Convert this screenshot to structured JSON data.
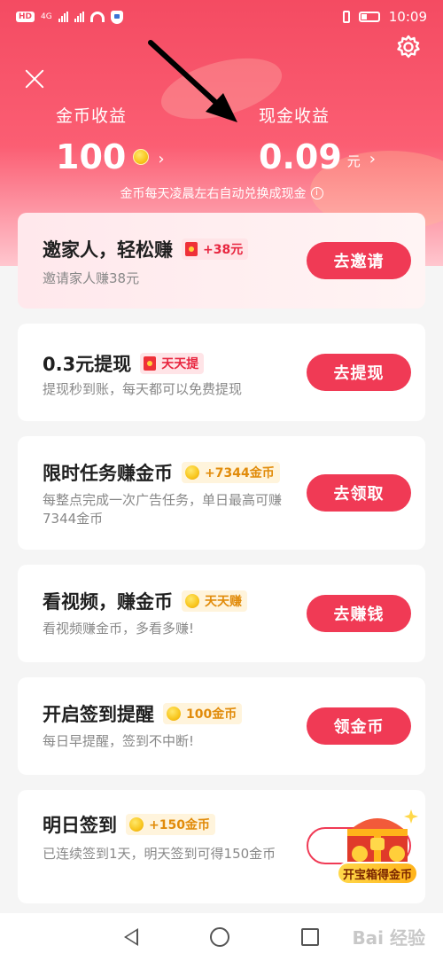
{
  "statusbar": {
    "chip": "HD",
    "network": "4G",
    "time": "10:09"
  },
  "header": {
    "coin_label": "金币收益",
    "coin_value": "100",
    "cash_label": "现金收益",
    "cash_value": "0.09",
    "cash_unit": "元",
    "hint": "金币每天凌晨左右自动兑换成现金"
  },
  "cards": [
    {
      "title": "邀家人，轻松赚",
      "tag": "+38元",
      "desc": "邀请家人赚38元",
      "button": "去邀请"
    },
    {
      "title": "0.3元提现",
      "tag": "天天提",
      "desc": "提现秒到账，每天都可以免费提现",
      "button": "去提现"
    },
    {
      "title": "限时任务赚金币",
      "tag": "+7344金币",
      "desc": "每整点完成一次广告任务，单日最高可赚7344金币",
      "button": "去领取"
    },
    {
      "title": "看视频，赚金币",
      "tag": "天天赚",
      "desc": "看视频赚金币，多看多赚!",
      "button": "去赚钱"
    },
    {
      "title": "开启签到提醒",
      "tag": "100金币",
      "desc": "每日早提醒，签到不中断!",
      "button": "领金币"
    },
    {
      "title": "明日签到",
      "tag": "+150金币",
      "desc": "已连续签到1天，明天签到可得150金币",
      "button": "去"
    }
  ],
  "chest": {
    "label": "开宝箱得金币"
  },
  "watermark": "Bai 经验"
}
